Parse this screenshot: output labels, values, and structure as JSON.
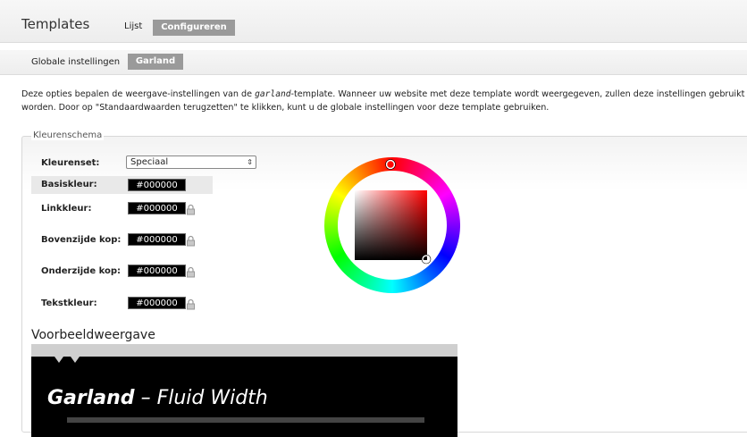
{
  "header": {
    "title": "Templates",
    "tabs": [
      {
        "label": "Lijst",
        "active": false
      },
      {
        "label": "Configureren",
        "active": true
      }
    ]
  },
  "subtabs": [
    {
      "label": "Globale instellingen",
      "active": false
    },
    {
      "label": "Garland",
      "active": true
    }
  ],
  "description": {
    "part1": "Deze opties bepalen de weergave-instellingen van de ",
    "theme": "garland",
    "part2": "-template. Wanneer uw website met deze template wordt weergegeven, zullen deze instellingen gebruikt worden. Door op \"Standaardwaarden terugzetten\" te klikken, kunt u de globale instellingen voor deze template gebruiken."
  },
  "color_scheme": {
    "legend": "Kleurenschema",
    "set_label": "Kleurenset:",
    "set_value": "Speciaal",
    "fields": [
      {
        "label": "Basiskleur:",
        "value": "#000000",
        "locked": false
      },
      {
        "label": "Linkkleur:",
        "value": "#000000",
        "locked": true
      },
      {
        "label": "Bovenzijde kop:",
        "value": "#000000",
        "locked": true
      },
      {
        "label": "Onderzijde kop:",
        "value": "#000000",
        "locked": true
      },
      {
        "label": "Tekstkleur:",
        "value": "#000000",
        "locked": true
      }
    ],
    "picker_hue": "#ff0000"
  },
  "preview": {
    "title": "Voorbeeldweergave",
    "site_name": "Garland",
    "separator": "–",
    "slogan": "Fluid Width"
  },
  "colors": {
    "tab_active_bg": "#9a9a9a",
    "preview_bg": "#000000"
  }
}
